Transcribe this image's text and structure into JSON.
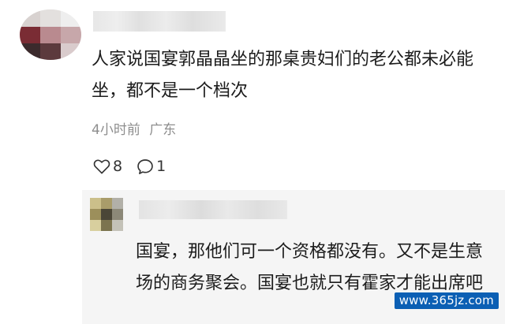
{
  "comments": [
    {
      "text": "人家说国宴郭晶晶坐的那桌贵妇们的老公都未必能坐，都不是一个档次",
      "time": "4小时前",
      "location": "广东",
      "likes": "8",
      "replies": "1",
      "icons": {
        "like": "heart-outline-icon",
        "comment": "speech-bubble-icon"
      }
    }
  ],
  "reply": {
    "text": "国宴，那他们可一个资格都没有。又不是生意场的商务聚会。国宴也就只有霍家才能出席吧"
  },
  "watermark": {
    "text": "www.365jz.com",
    "color": "#0b5fb4"
  }
}
